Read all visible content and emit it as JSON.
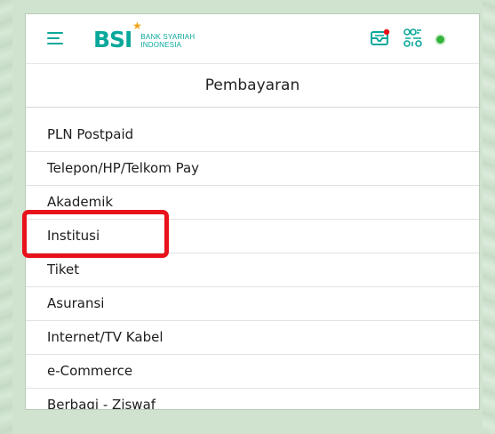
{
  "header": {
    "logo_mark": "BSI",
    "logo_text_line1": "BANK SYARIAH",
    "logo_text_line2": "INDONESIA",
    "icons": [
      "menu-icon",
      "mail-icon",
      "qr-icon",
      "status-dot"
    ]
  },
  "page": {
    "title": "Pembayaran"
  },
  "menu": {
    "items": [
      {
        "label": "PLN Postpaid"
      },
      {
        "label": "Telepon/HP/Telkom Pay"
      },
      {
        "label": "Akademik"
      },
      {
        "label": "Institusi",
        "highlighted": true
      },
      {
        "label": "Tiket"
      },
      {
        "label": "Asuransi"
      },
      {
        "label": "Internet/TV Kabel"
      },
      {
        "label": "e-Commerce"
      },
      {
        "label": "Berbagi - Ziswaf"
      }
    ]
  },
  "colors": {
    "brand": "#0aa89b",
    "accent_star": "#f2a51a",
    "highlight": "#e8121b",
    "status": "#32b33a"
  }
}
